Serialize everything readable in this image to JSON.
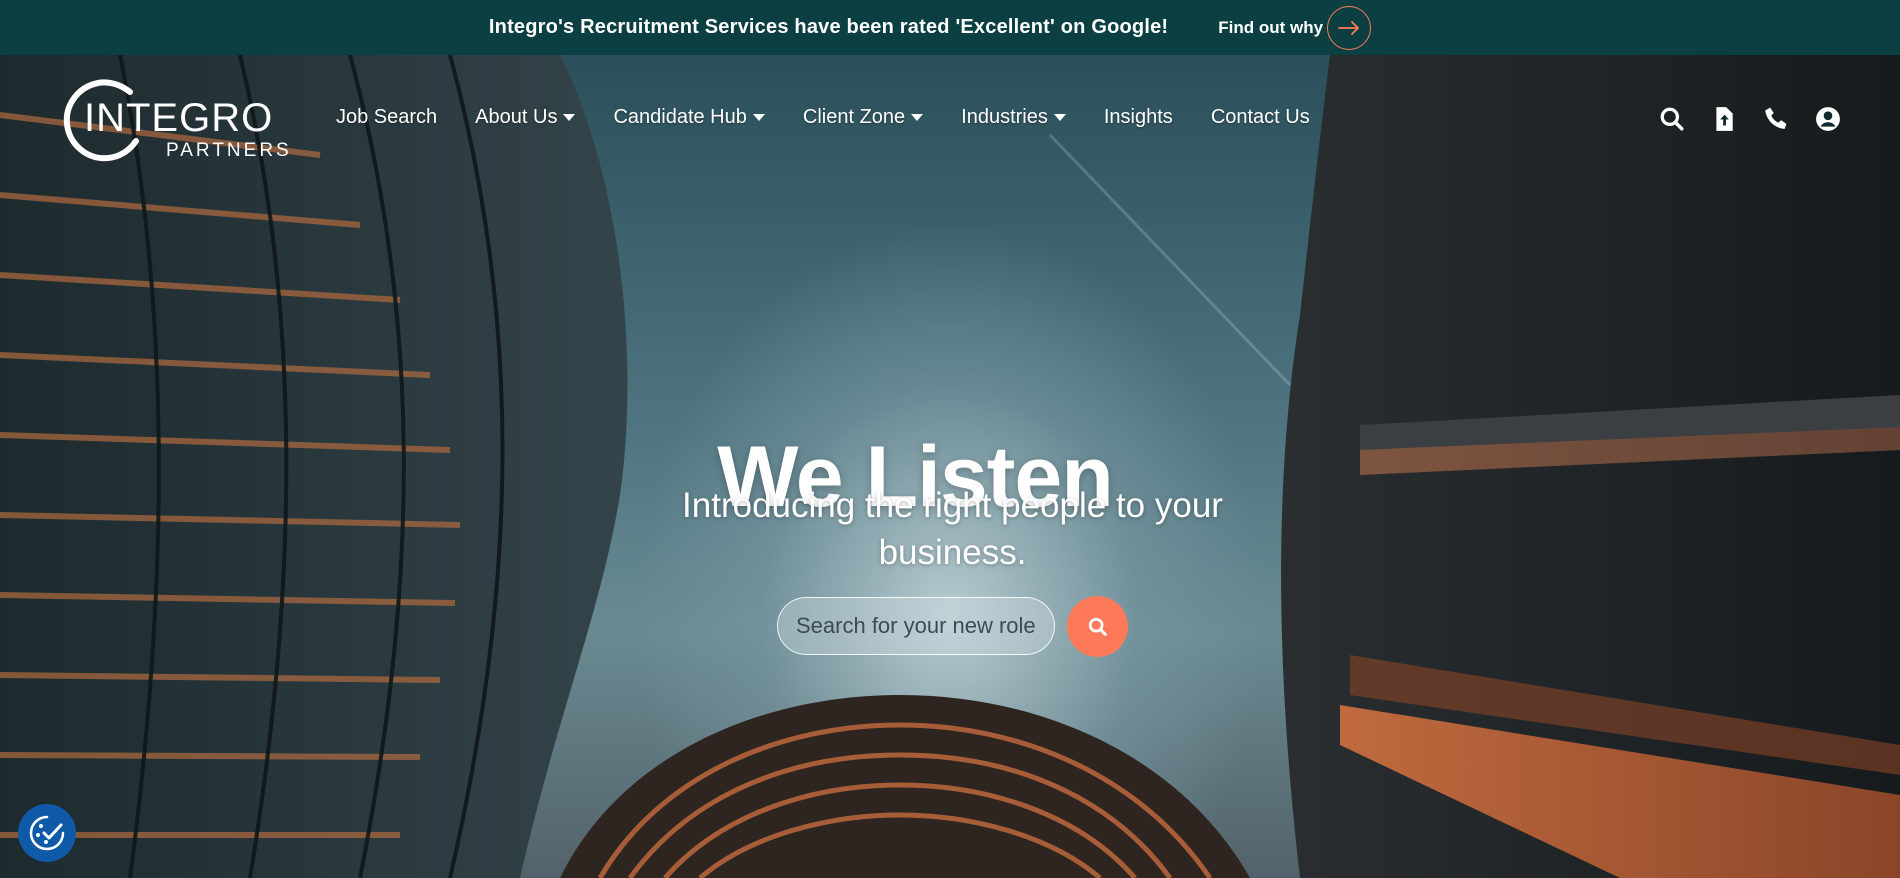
{
  "banner": {
    "text": "Integro's Recruitment Services have been rated 'Excellent' on Google!",
    "link_label": "Find out why",
    "accent": "#ff7a59",
    "background": "#0b3f42"
  },
  "brand": {
    "name": "INTEGRO",
    "tagline": "PARTNERS"
  },
  "nav": {
    "items": [
      {
        "label": "Job Search",
        "dropdown": false
      },
      {
        "label": "About Us",
        "dropdown": true
      },
      {
        "label": "Candidate Hub",
        "dropdown": true
      },
      {
        "label": "Client Zone",
        "dropdown": true
      },
      {
        "label": "Industries",
        "dropdown": true
      },
      {
        "label": "Insights",
        "dropdown": false
      },
      {
        "label": "Contact Us",
        "dropdown": false
      }
    ]
  },
  "tools": {
    "icons": [
      "search-icon",
      "upload-cv-icon",
      "phone-icon",
      "user-account-icon"
    ]
  },
  "hero": {
    "headline": "We Listen",
    "subheadline": "Introducing the right people to your business.",
    "search_placeholder": "Search for your new role",
    "search_button_color": "#ff7a59"
  },
  "cookie": {
    "icon": "cookie-consent-icon",
    "color": "#0f5aa8"
  }
}
